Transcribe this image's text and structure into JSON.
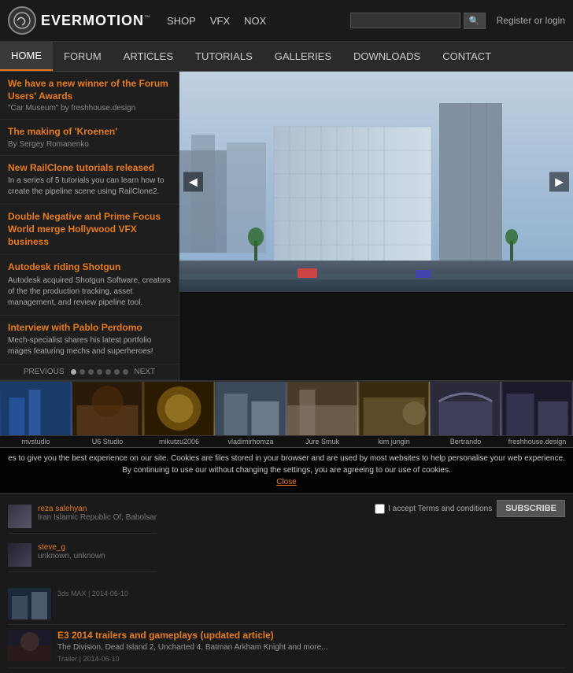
{
  "header": {
    "logo_text": "EVERMOTION",
    "logo_tm": "™",
    "nav_items": [
      "SHOP",
      "VFX",
      "NOX"
    ],
    "search_placeholder": "",
    "auth_text": "Register or login"
  },
  "main_nav": {
    "items": [
      "HOME",
      "FORUM",
      "ARTICLES",
      "TUTORIALS",
      "GALLERIES",
      "DOWNLOADS",
      "CONTACT"
    ],
    "active": "HOME"
  },
  "sidebar": {
    "items": [
      {
        "title": "We have a new winner of the Forum Users' Awards",
        "subtitle": "\"Car Museum\" by freshhouse.design",
        "desc": ""
      },
      {
        "title": "The making of 'Kroenen'",
        "subtitle": "By Sergey Romanenko",
        "desc": ""
      },
      {
        "title": "New RailClone tutorials released",
        "subtitle": "",
        "desc": "In a series of 5 tutorials you can learn how to create the pipeline scene using RailClone2."
      },
      {
        "title": "Double Negative and Prime Focus World merge Hollywood VFX business",
        "subtitle": "",
        "desc": ""
      },
      {
        "title": "Autodesk riding Shotgun",
        "subtitle": "",
        "desc": "Autodesk acquired Shotgun Software, creators of the the production tracking, asset management, and review pipeline tool."
      },
      {
        "title": "Interview with Pablo Perdomo",
        "subtitle": "",
        "desc": "Mech-specialist shares his latest portfolio mages featuring mechs and superheroes!"
      }
    ]
  },
  "slide_controls": {
    "prev": "PREVIOUS",
    "next": "NEXT",
    "dots": 7
  },
  "thumbnails": [
    {
      "label": "mvstudio",
      "color": "blue"
    },
    {
      "label": "U6 Studio",
      "color": "brown"
    },
    {
      "label": "mikutzu2006",
      "color": "gold"
    },
    {
      "label": "vladimirhomza",
      "color": "gray"
    },
    {
      "label": "Jure Smuk",
      "color": "beige"
    },
    {
      "label": "kim jungin",
      "color": "tan"
    },
    {
      "label": "Bertrando",
      "color": "arch"
    },
    {
      "label": "freshhouse.design",
      "color": "dark"
    }
  ],
  "cookie_bar": {
    "text": "es to give you the best experience on our site. Cookies are files stored in your browser and are used by most websites to help personalise your web experience. By continuing to use our without changing the settings, you are agreeing to our use of cookies.",
    "close_label": "Close"
  },
  "bottom_section": {
    "users": [
      {
        "name": "reza salehyan",
        "location": "Iran Islamic Republic Of, Babolsar"
      },
      {
        "name": "steve_g",
        "location": "unknown, unknown"
      }
    ],
    "subscribe": {
      "checkbox_label": "I accept Terms and conditions",
      "button_label": "SUBSCRIBE"
    }
  },
  "news": [
    {
      "title": "3ds MAX  |  2014-06-10",
      "headline": "",
      "desc": "",
      "meta": ""
    },
    {
      "title": "E3 2014 trailers and gameplays (updated article)",
      "desc": "The Division, Dead Island 2, Uncharted 4, Batman Arkham Knight and more...",
      "meta": "Trailer  |  2014-06-10"
    }
  ]
}
